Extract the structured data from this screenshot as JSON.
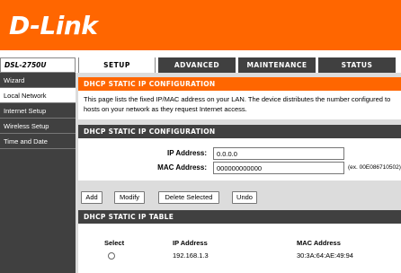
{
  "brand": {
    "logo_text": "D-Link"
  },
  "model": "DSL-2750U",
  "tabs": [
    {
      "label": "SETUP",
      "active": true
    },
    {
      "label": "ADVANCED",
      "active": false
    },
    {
      "label": "MAINTENANCE",
      "active": false
    },
    {
      "label": "STATUS",
      "active": false
    }
  ],
  "sidebar": {
    "items": [
      {
        "label": "Wizard",
        "active": false
      },
      {
        "label": "Local Network",
        "active": true
      },
      {
        "label": "Internet Setup",
        "active": false
      },
      {
        "label": "Wireless Setup",
        "active": false
      },
      {
        "label": "Time and Date",
        "active": false
      }
    ]
  },
  "intro": {
    "title": "DHCP STATIC IP CONFIGURATION",
    "description": "This page lists the fixed IP/MAC address on your LAN. The device distributes the number configured to hosts on your network as they request Internet access."
  },
  "config": {
    "title": "DHCP STATIC IP CONFIGURATION",
    "ip_label": "IP Address:",
    "ip_value": "0.0.0.0",
    "mac_label": "MAC Address:",
    "mac_value": "000000000000",
    "mac_hint": "(ex. 00E086710502)"
  },
  "buttons": {
    "add": "Add",
    "modify": "Modify",
    "delete": "Delete Selected",
    "undo": "Undo"
  },
  "table": {
    "title": "DHCP STATIC IP TABLE",
    "headers": {
      "select": "Select",
      "ip": "IP Address",
      "mac": "MAC Address"
    },
    "rows": [
      {
        "ip": "192.168.1.3",
        "mac": "30:3A:64:AE:49:94"
      }
    ]
  },
  "colors": {
    "accent": "#ff6600",
    "dark": "#404040"
  }
}
